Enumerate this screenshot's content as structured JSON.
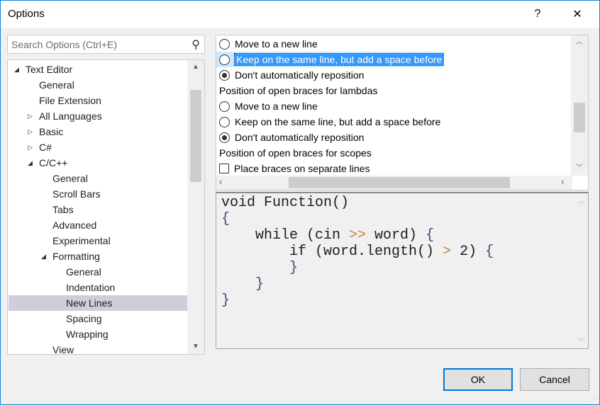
{
  "window": {
    "title": "Options",
    "help": "?",
    "close": "✕"
  },
  "search": {
    "placeholder": "Search Options (Ctrl+E)"
  },
  "tree": [
    {
      "label": "Text Editor",
      "level": 0,
      "arrow": "down"
    },
    {
      "label": "General",
      "level": 1
    },
    {
      "label": "File Extension",
      "level": 1
    },
    {
      "label": "All Languages",
      "level": 1,
      "arrow": "right"
    },
    {
      "label": "Basic",
      "level": 1,
      "arrow": "right"
    },
    {
      "label": "C#",
      "level": 1,
      "arrow": "right"
    },
    {
      "label": "C/C++",
      "level": 1,
      "arrow": "down"
    },
    {
      "label": "General",
      "level": 2
    },
    {
      "label": "Scroll Bars",
      "level": 2
    },
    {
      "label": "Tabs",
      "level": 2
    },
    {
      "label": "Advanced",
      "level": 2
    },
    {
      "label": "Experimental",
      "level": 2
    },
    {
      "label": "Formatting",
      "level": 2,
      "arrow": "down"
    },
    {
      "label": "General",
      "level": 3
    },
    {
      "label": "Indentation",
      "level": 3
    },
    {
      "label": "New Lines",
      "level": 3,
      "selected": true
    },
    {
      "label": "Spacing",
      "level": 3
    },
    {
      "label": "Wrapping",
      "level": 3
    },
    {
      "label": "View",
      "level": 2
    }
  ],
  "options": {
    "r1": "Move to a new line",
    "r2": "Keep on the same line, but add a space before",
    "r3": "Don't automatically reposition",
    "h1": "Position of open braces for lambdas",
    "r4": "Move to a new line",
    "r5": "Keep on the same line, but add a space before",
    "r6": "Don't automatically reposition",
    "h2": "Position of open braces for scopes",
    "c1": "Place braces on separate lines"
  },
  "code": {
    "l1": "void Function()",
    "l2": "{",
    "l3a": "    while (cin ",
    "l3op": ">>",
    "l3b": " word) ",
    "l3br": "{",
    "l4a": "        if (word.length() ",
    "l4op": ">",
    "l4b": " 2) ",
    "l4br": "{",
    "l5": "        }",
    "l6": "    }",
    "l7": "}"
  },
  "buttons": {
    "ok": "OK",
    "cancel": "Cancel"
  }
}
